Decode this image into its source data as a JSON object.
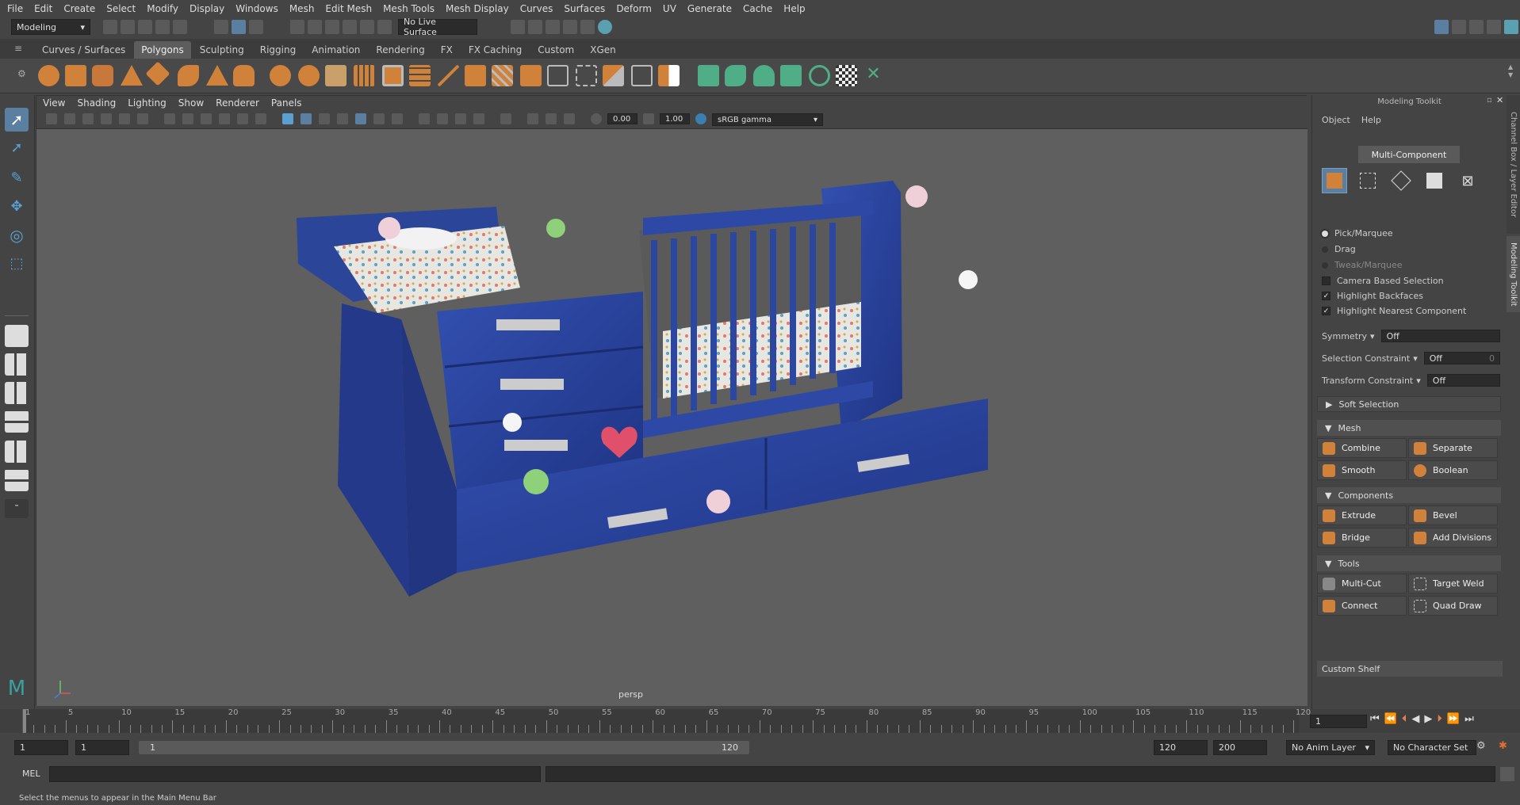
{
  "menubar": {
    "items": [
      "File",
      "Edit",
      "Create",
      "Select",
      "Modify",
      "Display",
      "Windows",
      "Mesh",
      "Edit Mesh",
      "Mesh Tools",
      "Mesh Display",
      "Curves",
      "Surfaces",
      "Deform",
      "UV",
      "Generate",
      "Cache",
      "Help"
    ]
  },
  "statusline": {
    "workspace": "Modeling",
    "live_surface": "No Live Surface"
  },
  "shelf": {
    "tabs": [
      "Curves / Surfaces",
      "Polygons",
      "Sculpting",
      "Rigging",
      "Animation",
      "Rendering",
      "FX",
      "FX Caching",
      "Custom",
      "XGen"
    ],
    "active": "Polygons"
  },
  "viewport": {
    "menu": [
      "View",
      "Shading",
      "Lighting",
      "Show",
      "Renderer",
      "Panels"
    ],
    "exposure": "0.00",
    "gamma": "1.00",
    "color_space": "sRGB gamma",
    "camera_label": "persp"
  },
  "modeling_toolkit": {
    "title": "Modeling Toolkit",
    "menu": [
      "Object",
      "Help"
    ],
    "mode": "Multi-Component",
    "pick_options": [
      "Pick/Marquee",
      "Drag",
      "Tweak/Marquee"
    ],
    "camera_based_selection": "Camera Based Selection",
    "highlight_backfaces": "Highlight Backfaces",
    "highlight_nearest": "Highlight Nearest Component",
    "symmetry_label": "Symmetry",
    "symmetry_value": "Off",
    "sel_constraint_label": "Selection Constraint",
    "sel_constraint_value": "Off",
    "sel_constraint_num": "0",
    "transform_constraint_label": "Transform Constraint",
    "transform_constraint_value": "Off",
    "soft_selection": "Soft Selection",
    "mesh_header": "Mesh",
    "mesh_buttons": [
      "Combine",
      "Separate",
      "Smooth",
      "Boolean"
    ],
    "components_header": "Components",
    "components_buttons": [
      "Extrude",
      "Bevel",
      "Bridge",
      "Add Divisions"
    ],
    "tools_header": "Tools",
    "tools_buttons": [
      "Multi-Cut",
      "Target Weld",
      "Connect",
      "Quad Draw"
    ],
    "custom_shelf": "Custom Shelf",
    "side_tabs": [
      "Channel Box / Layer Editor",
      "Modeling Toolkit"
    ]
  },
  "timeline": {
    "ticks": [
      "1",
      "5",
      "10",
      "15",
      "20",
      "25",
      "30",
      "35",
      "40",
      "45",
      "50",
      "55",
      "60",
      "65",
      "70",
      "75",
      "80",
      "85",
      "90",
      "95",
      "100",
      "105",
      "110",
      "115",
      "120"
    ],
    "current_frame": "1",
    "range_start": "1",
    "range_start2": "1",
    "range_slider_start": "1",
    "range_slider_end": "120",
    "range_end": "120",
    "range_end2": "200",
    "anim_layer": "No Anim Layer",
    "character_set": "No Character Set"
  },
  "cmdline": {
    "lang": "MEL"
  },
  "helpline": {
    "text": "Select the menus to appear in the Main Menu Bar"
  },
  "colors": {
    "accent_orange": "#d0813a",
    "viewport_bg": "#5f5f5f",
    "crib_blue": "#27419a"
  }
}
